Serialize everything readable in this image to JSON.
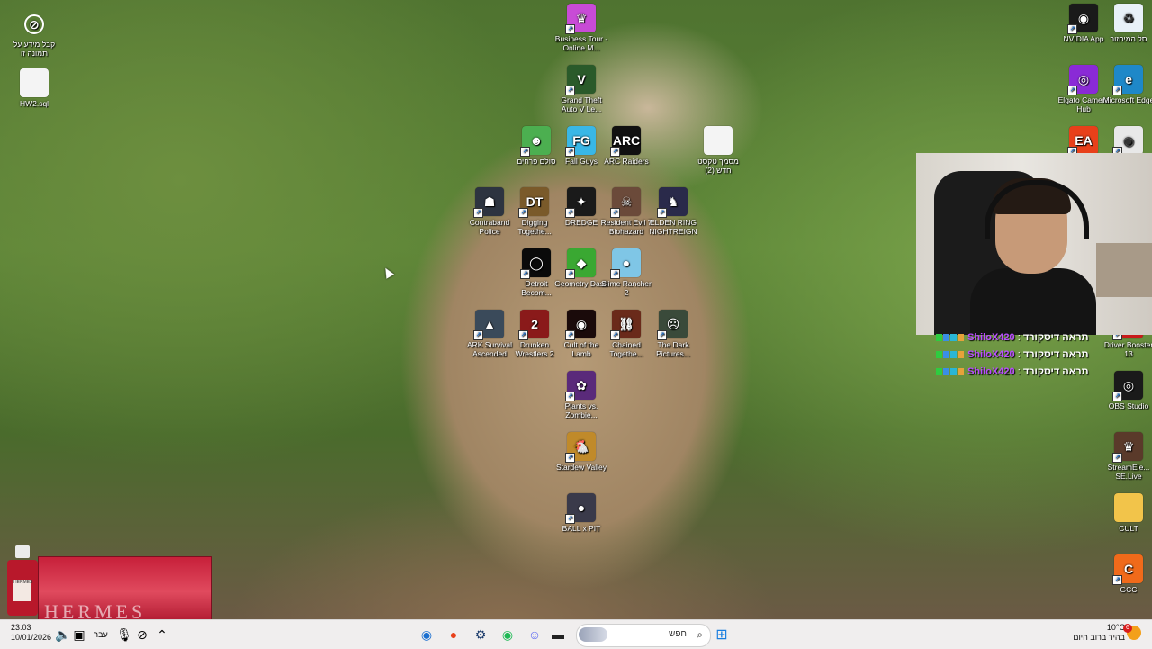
{
  "desktop": {
    "icons": [
      {
        "id": "about-this-image",
        "label": "קבל מידע על תמונה זו",
        "icon": "info-compass-icon",
        "color": "#2b2b2b",
        "glyph": "⊘"
      },
      {
        "id": "hw2-sql",
        "label": "HW2.sql",
        "icon": "document-icon",
        "color": "#f4f4f4",
        "glyph": ""
      },
      {
        "id": "business-tour",
        "label": "Business Tour - Online M...",
        "icon": "business-tour-icon",
        "color": "#c84bd6",
        "glyph": "♛"
      },
      {
        "id": "gta5",
        "label": "Grand Theft Auto V Le...",
        "icon": "gta-icon",
        "color": "#2a5a2a",
        "glyph": "V"
      },
      {
        "id": "ladder",
        "label": "סולם פרחים",
        "icon": "ladder-icon",
        "color": "#4caf50",
        "glyph": "☻"
      },
      {
        "id": "fall-guys",
        "label": "Fall Guys",
        "icon": "fall-guys-icon",
        "color": "#39b7e6",
        "glyph": "FG"
      },
      {
        "id": "arc-raiders",
        "label": "ARC Raiders",
        "icon": "arc-raiders-icon",
        "color": "#111111",
        "glyph": "ARC"
      },
      {
        "id": "new-text",
        "label": "מסמך טקסט חדש (2)",
        "icon": "text-file-icon",
        "color": "#f4f4f4",
        "glyph": ""
      },
      {
        "id": "contraband-police",
        "label": "Contraband Police",
        "icon": "contraband-police-icon",
        "color": "#2d3440",
        "glyph": "☗"
      },
      {
        "id": "digging-together",
        "label": "Digging Togethe...",
        "icon": "digging-together-icon",
        "color": "#7a5a2a",
        "glyph": "DT"
      },
      {
        "id": "dredge",
        "label": "DREDGE",
        "icon": "dredge-icon",
        "color": "#1a1a1a",
        "glyph": "✦"
      },
      {
        "id": "resident-evil-7",
        "label": "Resident Evil 7 Biohazard",
        "icon": "resident-evil-icon",
        "color": "#6b4a3a",
        "glyph": "☠"
      },
      {
        "id": "elden-ring",
        "label": "ELDEN RING NIGHTREIGN",
        "icon": "elden-ring-icon",
        "color": "#2a2a4a",
        "glyph": "♞"
      },
      {
        "id": "detroit",
        "label": "Detroit Becom...",
        "icon": "detroit-icon",
        "color": "#0a0a0a",
        "glyph": "◯"
      },
      {
        "id": "geometry-dash",
        "label": "Geometry Dash",
        "icon": "geometry-dash-icon",
        "color": "#3aa832",
        "glyph": "◆"
      },
      {
        "id": "slime-rancher-2",
        "label": "Slime Rancher 2",
        "icon": "slime-rancher-icon",
        "color": "#7fc6e6",
        "glyph": "●"
      },
      {
        "id": "ark",
        "label": "ARK Survival Ascended",
        "icon": "ark-icon",
        "color": "#3a4a5a",
        "glyph": "▲"
      },
      {
        "id": "drunken-wrestlers",
        "label": "Drunken Wrestlers 2",
        "icon": "drunken-wrestlers-icon",
        "color": "#8a1a1a",
        "glyph": "2"
      },
      {
        "id": "cult-of-the-lamb",
        "label": "Cult of the Lamb",
        "icon": "cult-of-the-lamb-icon",
        "color": "#1a0a0a",
        "glyph": "◉"
      },
      {
        "id": "chained-together",
        "label": "Chained Togethe...",
        "icon": "chained-together-icon",
        "color": "#6a2a1a",
        "glyph": "⛓"
      },
      {
        "id": "dark-pictures",
        "label": "The Dark Pictures...",
        "icon": "dark-pictures-icon",
        "color": "#3a4a3a",
        "glyph": "☹"
      },
      {
        "id": "pvz",
        "label": "Plants vs. Zombie...",
        "icon": "plants-vs-zombies-icon",
        "color": "#5a2a7a",
        "glyph": "✿"
      },
      {
        "id": "stardew",
        "label": "Stardew Valley",
        "icon": "stardew-valley-icon",
        "color": "#c08a2a",
        "glyph": "🐔"
      },
      {
        "id": "ball-x-pit",
        "label": "BALL x PIT",
        "icon": "ball-x-pit-icon",
        "color": "#3a3a4a",
        "glyph": "●"
      },
      {
        "id": "nvidia-app",
        "label": "NVIDIA App",
        "icon": "nvidia-icon",
        "color": "#1a1a1a",
        "glyph": "◉"
      },
      {
        "id": "recycle-bin",
        "label": "סל המיחזור",
        "icon": "recycle-bin-icon",
        "color": "#e8f1f8",
        "glyph": "♻"
      },
      {
        "id": "elgato",
        "label": "Elgato Camera Hub",
        "icon": "elgato-icon",
        "color": "#8a2ad6",
        "glyph": "◎"
      },
      {
        "id": "edge",
        "label": "Microsoft Edge",
        "icon": "edge-icon",
        "color": "#1e88c8",
        "glyph": "e"
      },
      {
        "id": "ea",
        "label": "EA",
        "icon": "ea-icon",
        "color": "#e8401a",
        "glyph": "EA"
      },
      {
        "id": "chrome",
        "label": "Google Chrome",
        "icon": "chrome-icon",
        "color": "#e8e8e8",
        "glyph": "◉"
      },
      {
        "id": "driver-booster",
        "label": "Driver Booster 13",
        "icon": "driver-booster-icon",
        "color": "#c81a1a",
        "glyph": "⚙"
      },
      {
        "id": "obs",
        "label": "OBS Studio",
        "icon": "obs-icon",
        "color": "#1a1a1a",
        "glyph": "◎"
      },
      {
        "id": "streamelements",
        "label": "StreamEle... SE.Live",
        "icon": "streamelements-icon",
        "color": "#5a3a2a",
        "glyph": "♛"
      },
      {
        "id": "cult-folder",
        "label": "CULT",
        "icon": "folder-icon",
        "color": "#f2c44a",
        "glyph": ""
      },
      {
        "id": "gcc",
        "label": "GCC",
        "icon": "gcc-icon",
        "color": "#f06a1a",
        "glyph": "C"
      }
    ]
  },
  "chat": {
    "lines": [
      {
        "user": "ShiloX420",
        "sep": " : ",
        "msg": "תראה דיסקורד"
      },
      {
        "user": "ShiloX420",
        "sep": " : ",
        "msg": "תראה דיסקורד"
      },
      {
        "user": "ShiloX420",
        "sep": " : ",
        "msg": "תראה דיסקורד"
      }
    ]
  },
  "promo": {
    "bottle_label": "HERMES",
    "card_word": "HERMES"
  },
  "taskbar": {
    "time": "23:03",
    "date": "10/01/2026",
    "language": "עבר",
    "search_placeholder": "חפש",
    "weather_temp": "10°C",
    "weather_desc": "בהיר ברוב היום",
    "notification_count": "6"
  },
  "colors": {
    "taskbar_bg": "#f0eeee",
    "chat_user": "#b94cff",
    "promo_red": "#c7203a"
  }
}
